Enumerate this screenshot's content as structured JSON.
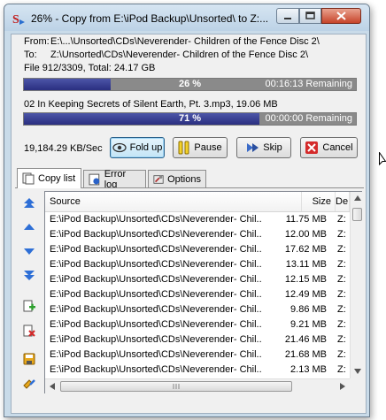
{
  "window": {
    "title": "26% - Copy from E:\\iPod Backup\\Unsorted\\ to Z:..."
  },
  "transfer": {
    "from_label": "From:",
    "from_path": "E:\\...\\Unsorted\\CDs\\Neverender- Children of the Fence Disc 2\\",
    "to_label": "To:",
    "to_path": "Z:\\Unsorted\\CDs\\Neverender- Children of the Fence Disc 2\\",
    "file_info": "File 912/3309, Total: 24.17 GB",
    "total_progress": {
      "percent": 26,
      "label": "26 %",
      "remaining": "00:16:13 Remaining"
    },
    "current_file": "02 In Keeping Secrets of Silent Earth, Pt. 3.mp3, 19.06 MB",
    "file_progress": {
      "percent": 71,
      "label": "71 %",
      "remaining": "00:00:00 Remaining"
    },
    "speed": "19,184.29 KB/Sec"
  },
  "buttons": {
    "fold_up": "Fold up",
    "pause": "Pause",
    "skip": "Skip",
    "cancel": "Cancel"
  },
  "tabs": [
    {
      "label": "Copy list",
      "icon": "copy-list-icon",
      "selected": true
    },
    {
      "label": "Error log",
      "icon": "error-log-icon",
      "selected": false
    },
    {
      "label": "Options",
      "icon": "options-icon",
      "selected": false
    }
  ],
  "side_icons": [
    "move-top-icon",
    "move-up-icon",
    "move-down-icon",
    "move-bottom-icon",
    "add-file-icon",
    "remove-file-icon",
    "save-list-icon",
    "load-list-icon"
  ],
  "list": {
    "columns": {
      "source": "Source",
      "size": "Size",
      "dest": "De"
    },
    "rows": [
      {
        "source": "E:\\iPod Backup\\Unsorted\\CDs\\Neverender- Chil...",
        "size": "11.75 MB",
        "dest": "Z:"
      },
      {
        "source": "E:\\iPod Backup\\Unsorted\\CDs\\Neverender- Chil...",
        "size": "12.00 MB",
        "dest": "Z:"
      },
      {
        "source": "E:\\iPod Backup\\Unsorted\\CDs\\Neverender- Chil...",
        "size": "17.62 MB",
        "dest": "Z:"
      },
      {
        "source": "E:\\iPod Backup\\Unsorted\\CDs\\Neverender- Chil...",
        "size": "13.11 MB",
        "dest": "Z:"
      },
      {
        "source": "E:\\iPod Backup\\Unsorted\\CDs\\Neverender- Chil...",
        "size": "12.15 MB",
        "dest": "Z:"
      },
      {
        "source": "E:\\iPod Backup\\Unsorted\\CDs\\Neverender- Chil...",
        "size": "12.49 MB",
        "dest": "Z:"
      },
      {
        "source": "E:\\iPod Backup\\Unsorted\\CDs\\Neverender- Chil...",
        "size": "9.86 MB",
        "dest": "Z:"
      },
      {
        "source": "E:\\iPod Backup\\Unsorted\\CDs\\Neverender- Chil...",
        "size": "9.21 MB",
        "dest": "Z:"
      },
      {
        "source": "E:\\iPod Backup\\Unsorted\\CDs\\Neverender- Chil...",
        "size": "21.46 MB",
        "dest": "Z:"
      },
      {
        "source": "E:\\iPod Backup\\Unsorted\\CDs\\Neverender- Chil...",
        "size": "21.68 MB",
        "dest": "Z:"
      },
      {
        "source": "E:\\iPod Backup\\Unsorted\\CDs\\Neverender- Chil...",
        "size": "2.13 MB",
        "dest": "Z:"
      }
    ]
  }
}
